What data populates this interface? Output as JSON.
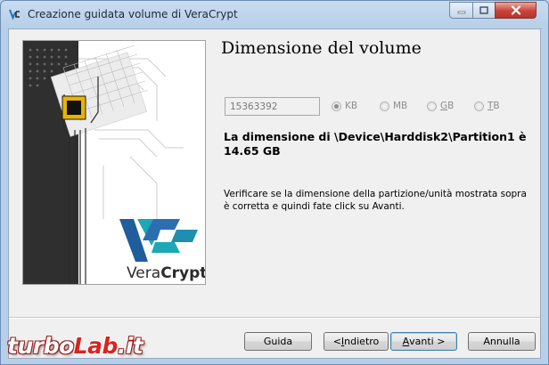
{
  "window": {
    "title": "Creazione guidata volume di VeraCrypt",
    "icon": "veracrypt-vc-icon"
  },
  "banner": {
    "brand_prefix": "Vera",
    "brand_suffix": "Crypt",
    "colors": {
      "teal": "#1ea7b5",
      "blue": "#1f5d9c",
      "dark": "#2b2b2b"
    }
  },
  "page": {
    "title": "Dimensione del volume",
    "size_value": "15363392",
    "units": [
      {
        "label": "KB",
        "checked": true
      },
      {
        "label": "MB",
        "checked": false
      },
      {
        "label": "GB",
        "accel": "G",
        "rest": "B",
        "checked": false
      },
      {
        "label": "TB",
        "accel": "T",
        "rest": "B",
        "checked": false
      }
    ],
    "size_info_line1": "La dimensione di \\Device\\Harddisk2\\Partition1 è",
    "size_info_line2": "14.65 GB",
    "help_text": "Verificare se la dimensione della partizione/unità mostrata sopra è corretta e quindi fate click su Avanti."
  },
  "buttons": {
    "help": "Guida",
    "back_accel": "<",
    "back_accel_under": "I",
    "back_rest": "ndietro",
    "next_accel": "A",
    "next_rest": "vanti >",
    "cancel": "Annulla"
  },
  "watermark": {
    "part1": "turbo",
    "part2": "Lab",
    "part3": ".it"
  }
}
